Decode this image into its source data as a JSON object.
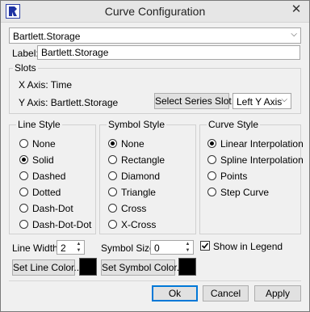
{
  "window": {
    "title": "Curve Configuration",
    "close_glyph": "✕",
    "app_icon": "app-logo-icon"
  },
  "series_select": {
    "value": "Bartlett.Storage"
  },
  "label_field": {
    "label": "Label:",
    "value": "Bartlett.Storage"
  },
  "slots": {
    "title": "Slots",
    "x_axis": "X Axis:  Time",
    "y_axis": "Y Axis:  Bartlett.Storage",
    "select_series_button": "Select Series Slot...",
    "axis_select": "Left Y Axis"
  },
  "line_style": {
    "title": "Line Style",
    "options": [
      "None",
      "Solid",
      "Dashed",
      "Dotted",
      "Dash-Dot",
      "Dash-Dot-Dot"
    ],
    "selected": "Solid"
  },
  "symbol_style": {
    "title": "Symbol Style",
    "options": [
      "None",
      "Rectangle",
      "Diamond",
      "Triangle",
      "Cross",
      "X-Cross"
    ],
    "selected": "None"
  },
  "curve_style": {
    "title": "Curve Style",
    "options": [
      "Linear Interpolation",
      "Spline Interpolation",
      "Points",
      "Step Curve"
    ],
    "selected": "Linear Interpolation"
  },
  "line_width": {
    "label": "Line Width",
    "value": "2"
  },
  "symbol_size": {
    "label": "Symbol Size",
    "value": "0"
  },
  "show_legend": {
    "label": "Show in Legend",
    "checked": true
  },
  "set_line_color_button": "Set Line Color...",
  "set_symbol_color_button": "Set Symbol Color...",
  "line_color": "#000000",
  "symbol_color": "#000000",
  "buttons": {
    "ok": "Ok",
    "cancel": "Cancel",
    "apply": "Apply"
  }
}
